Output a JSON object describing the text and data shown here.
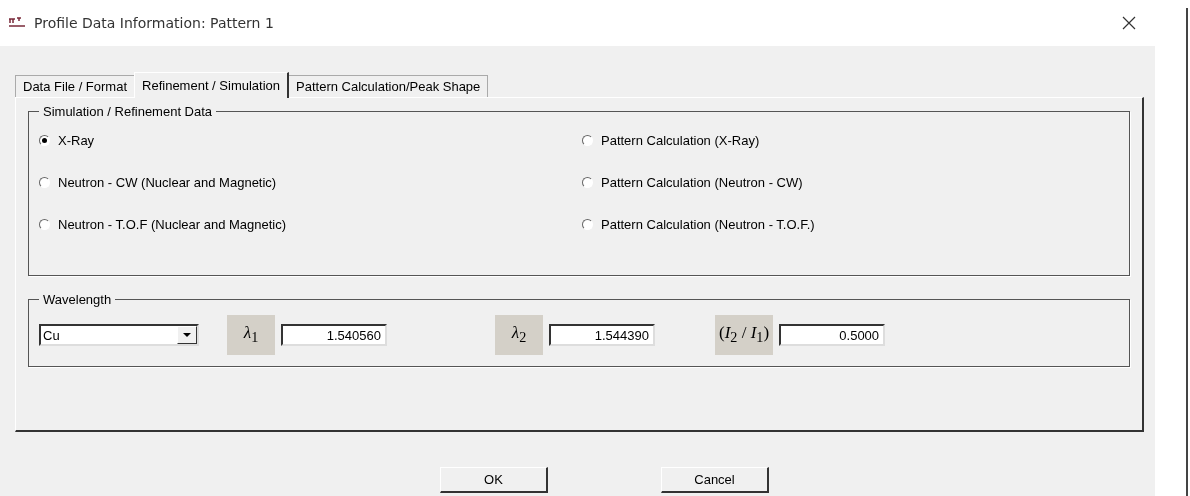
{
  "window": {
    "title": "Profile Data Information: Pattern 1"
  },
  "tabs": [
    {
      "label": "Data File / Format",
      "selected": false
    },
    {
      "label": "Refinement / Simulation",
      "selected": true
    },
    {
      "label": "Pattern Calculation/Peak Shape",
      "selected": false
    }
  ],
  "simulation_group": {
    "title": "Simulation / Refinement Data",
    "options": [
      {
        "label": "X-Ray",
        "selected": true
      },
      {
        "label": "Pattern Calculation (X-Ray)",
        "selected": false
      },
      {
        "label": "Neutron - CW (Nuclear and Magnetic)",
        "selected": false
      },
      {
        "label": "Pattern Calculation (Neutron - CW)",
        "selected": false
      },
      {
        "label": "Neutron - T.O.F (Nuclear and Magnetic)",
        "selected": false
      },
      {
        "label": "Pattern Calculation (Neutron - T.O.F.)",
        "selected": false
      }
    ]
  },
  "wavelength_group": {
    "title": "Wavelength",
    "source": "Cu",
    "fields": [
      {
        "label": "*λ*$_{1}$",
        "value": "1.540560"
      },
      {
        "label": "*λ*$_{2}$",
        "value": "1.544390"
      },
      {
        "label": "(*I*$_{2}$ / *I*$_{1}$)",
        "value": "0.5000"
      }
    ]
  },
  "buttons": [
    "OK",
    "Cancel"
  ]
}
